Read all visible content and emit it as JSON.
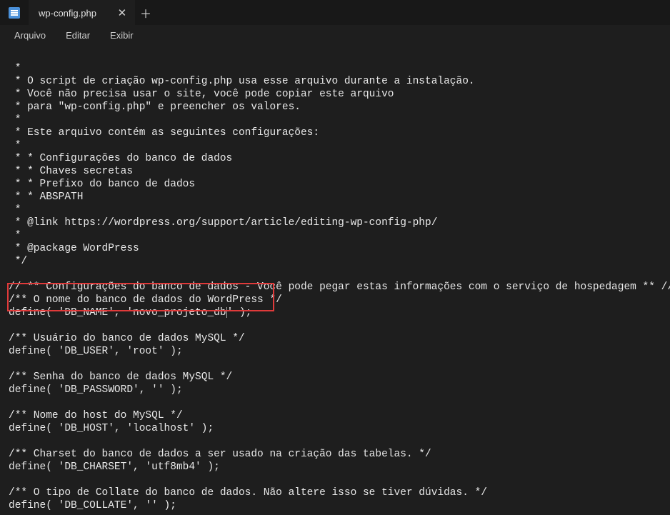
{
  "tab": {
    "filename": "wp-config.php"
  },
  "menu": {
    "arquivo": "Arquivo",
    "editar": "Editar",
    "exibir": "Exibir"
  },
  "code": {
    "l01": " *",
    "l02": " * O script de criação wp-config.php usa esse arquivo durante a instalação.",
    "l03": " * Você não precisa usar o site, você pode copiar este arquivo",
    "l04": " * para \"wp-config.php\" e preencher os valores.",
    "l05": " *",
    "l06": " * Este arquivo contém as seguintes configurações:",
    "l07": " *",
    "l08": " * * Configurações do banco de dados",
    "l09": " * * Chaves secretas",
    "l10": " * * Prefixo do banco de dados",
    "l11": " * * ABSPATH",
    "l12": " *",
    "l13": " * @link https://wordpress.org/support/article/editing-wp-config-php/",
    "l14": " *",
    "l15": " * @package WordPress",
    "l16": " */",
    "l17": "",
    "l18": "// ** Configurações do banco de dados - Você pode pegar estas informações com o serviço de hospedagem ** //",
    "l19": "/** O nome do banco de dados do WordPress */",
    "l20a": "define( 'DB_NAME', 'novo_projeto_db",
    "l20b": "' );",
    "l21": "",
    "l22": "/** Usuário do banco de dados MySQL */",
    "l23": "define( 'DB_USER', 'root' );",
    "l24": "",
    "l25": "/** Senha do banco de dados MySQL */",
    "l26": "define( 'DB_PASSWORD', '' );",
    "l27": "",
    "l28": "/** Nome do host do MySQL */",
    "l29": "define( 'DB_HOST', 'localhost' );",
    "l30": "",
    "l31": "/** Charset do banco de dados a ser usado na criação das tabelas. */",
    "l32": "define( 'DB_CHARSET', 'utf8mb4' );",
    "l33": "",
    "l34": "/** O tipo de Collate do banco de dados. Não altere isso se tiver dúvidas. */",
    "l35": "define( 'DB_COLLATE', '' );"
  }
}
